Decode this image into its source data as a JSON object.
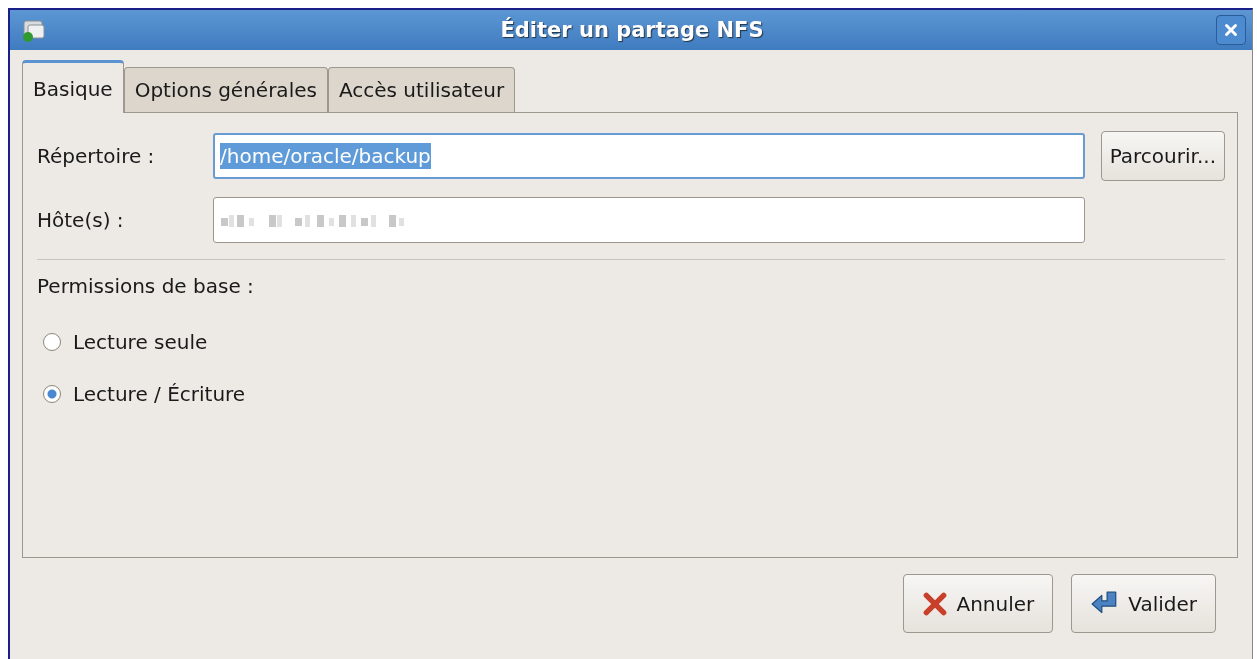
{
  "window": {
    "title": "Éditer un partage NFS"
  },
  "tabs": [
    {
      "label": "Basique",
      "selected": true
    },
    {
      "label": "Options générales",
      "selected": false
    },
    {
      "label": "Accès utilisateur",
      "selected": false
    }
  ],
  "fields": [
    {
      "label": "Répertoire :",
      "value": "/home/oracle/backup",
      "focused": true,
      "text_selected": true,
      "button": "Parcourir..."
    },
    {
      "label": "Hôte(s) :",
      "focused": false,
      "obscured": true
    }
  ],
  "permissions": {
    "heading": "Permissions de base :",
    "options": [
      {
        "label": "Lecture seule",
        "selected": false
      },
      {
        "label": "Lecture / Écriture",
        "selected": true
      }
    ]
  },
  "buttons": [
    {
      "kind": "cancel",
      "label": "Annuler"
    },
    {
      "kind": "ok",
      "label": "Valider"
    }
  ]
}
